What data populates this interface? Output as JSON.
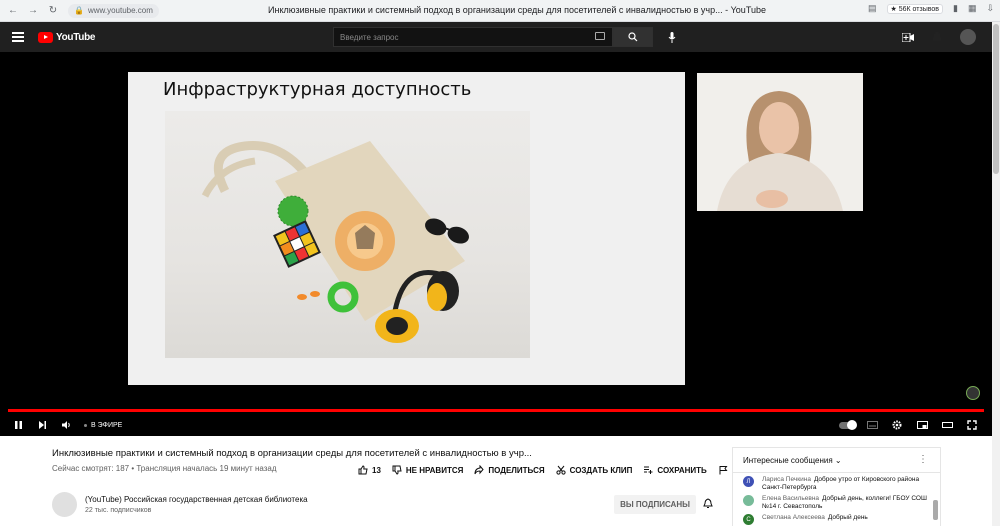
{
  "browser": {
    "url": "www.youtube.com",
    "tab_title": "Инклюзивные практики и системный подход в организации среды для посетителей с инвалидностью в учр... - YouTube",
    "reviews_badge": "★ 56К отзывов"
  },
  "header": {
    "logo": "YouTube",
    "search_placeholder": "Введите запрос"
  },
  "slide": {
    "title": "Инфраструктурная доступность"
  },
  "controls": {
    "live_label": "В ЭФИРЕ"
  },
  "video": {
    "title": "Инклюзивные практики и системный подход в организации среды для посетителей с инвалидностью в учр...",
    "meta": "Сейчас смотрят: 187 • Трансляция началась 19 минут назад",
    "likes": "13",
    "dislike_label": "НЕ НРАВИТСЯ",
    "share_label": "ПОДЕЛИТЬСЯ",
    "clip_label": "СОЗДАТЬ КЛИП",
    "save_label": "СОХРАНИТЬ"
  },
  "channel": {
    "name": "(YouTube) Российская государственная детская библиотека",
    "subscribers": "22 тыс. подписчиков",
    "subscribed_label": "ВЫ ПОДПИСАНЫ"
  },
  "chat": {
    "header": "Интересные сообщения",
    "messages": [
      {
        "initial": "Л",
        "color": "#3f51b5",
        "author": "Лариса Печкина",
        "text": "Доброе утро от Кировского района Санкт-Петербурга"
      },
      {
        "initial": "",
        "color": "#7b9",
        "author": "Елена Васильевна",
        "text": "Добрый день, коллеги! ГБОУ СОШ №14 г. Севастополь"
      },
      {
        "initial": "С",
        "color": "#2e7d32",
        "author": "Светлана Алексеева",
        "text": "Добрый день"
      }
    ]
  }
}
